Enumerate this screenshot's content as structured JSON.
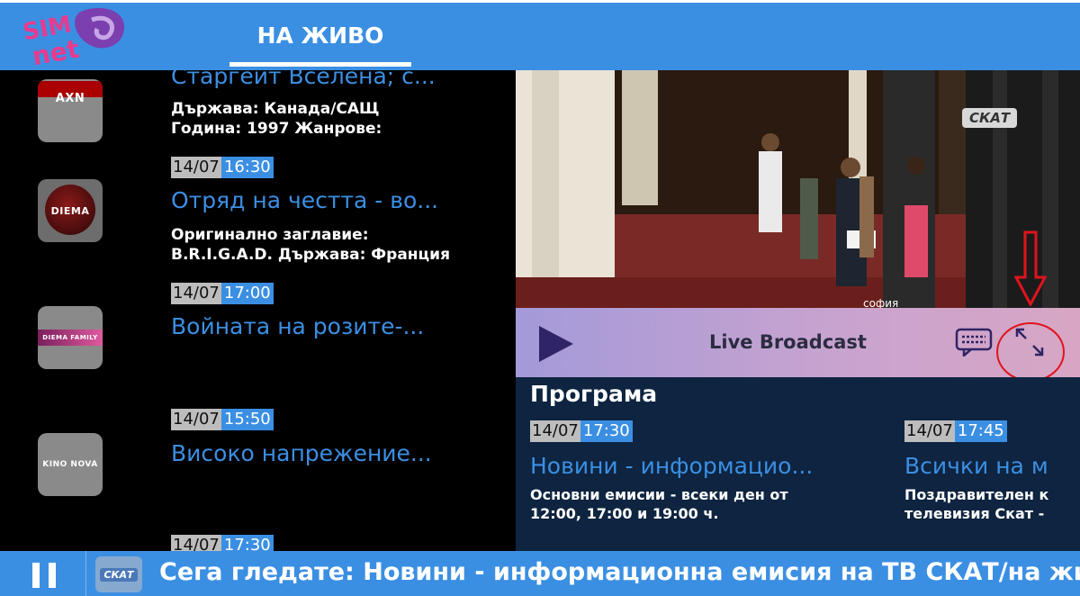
{
  "header": {
    "logo_text": [
      "SIM",
      "net"
    ],
    "tab_live": "НА ЖИВО"
  },
  "channels": [
    {
      "logo": "AXN",
      "title": "Старгейт Вселена; с...",
      "desc": [
        "Държава: Канада/САЩ",
        "Година: 1997 Жанрове:"
      ]
    },
    {
      "logo": "DIEMA",
      "date": "14/07",
      "time": "16:30",
      "title": "Отряд на честта - во...",
      "desc": [
        "Оригинално заглавие:",
        "B.R.I.G.A.D. Държава: Франция"
      ]
    },
    {
      "logo": "DIEMA FAMILY",
      "date": "14/07",
      "time": "17:00",
      "title": "Войната на розите-..."
    },
    {
      "logo": "KINO NOVA",
      "date": "14/07",
      "time": "15:50",
      "title": "Високо напрежение..."
    },
    {
      "date": "14/07",
      "time": "17:30"
    }
  ],
  "video": {
    "channel_logo": "СКАТ",
    "location_caption": "софия"
  },
  "controls": {
    "live_label": "Live Broadcast"
  },
  "program": {
    "heading": "Програма",
    "items": [
      {
        "date": "14/07",
        "time": "17:30",
        "title": "Новини - информацио...",
        "desc": [
          "Основни емисии - всеки ден от",
          "12:00, 17:00 и 19:00 ч."
        ]
      },
      {
        "date": "14/07",
        "time": "17:45",
        "title": "Всички на м",
        "desc": [
          "Поздравителен к",
          "телевизия Скат -"
        ]
      }
    ]
  },
  "now_playing": {
    "channel_logo": "СКАТ",
    "text": "Сега гледате: Новини - информационна емисия на ТВ СКАТ/на живо"
  },
  "colors": {
    "accent": "#3b8fe3",
    "program_bg": "#0e2440",
    "annotation_red": "#e0141b"
  }
}
